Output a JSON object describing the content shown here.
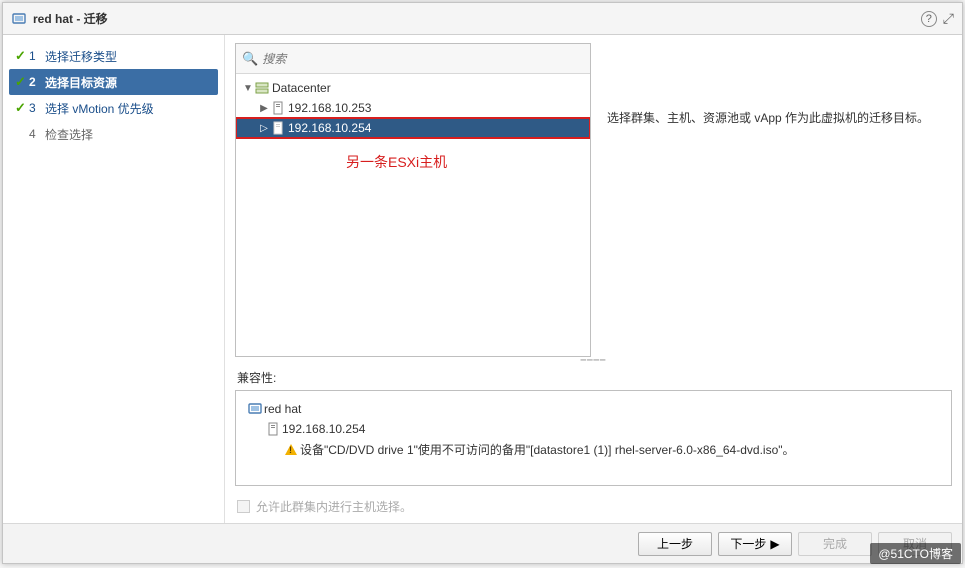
{
  "titlebar": {
    "title": "red hat - 迁移"
  },
  "sidebar": {
    "steps": [
      {
        "num": "1",
        "label": "选择迁移类型"
      },
      {
        "num": "2",
        "label": "选择目标资源"
      },
      {
        "num": "3",
        "label": "选择 vMotion 优先级"
      },
      {
        "num": "4",
        "label": "检查选择"
      }
    ]
  },
  "search": {
    "placeholder": "搜索"
  },
  "tree": {
    "root": "Datacenter",
    "host1": "192.168.10.253",
    "host2": "192.168.10.254"
  },
  "annotation": "另一条ESXi主机",
  "description": "选择群集、主机、资源池或 vApp 作为此虚拟机的迁移目标。",
  "compat": {
    "label": "兼容性:",
    "vm": "red hat",
    "host": "192.168.10.254",
    "warning": "设备\"CD/DVD drive 1\"使用不可访问的备用\"[datastore1 (1)] rhel-server-6.0-x86_64-dvd.iso\"。"
  },
  "checkbox": {
    "label": "允许此群集内进行主机选择。"
  },
  "footer": {
    "back": "上一步",
    "next": "下一步",
    "finish": "完成",
    "cancel": "取消"
  },
  "watermark": "@51CTO博客"
}
